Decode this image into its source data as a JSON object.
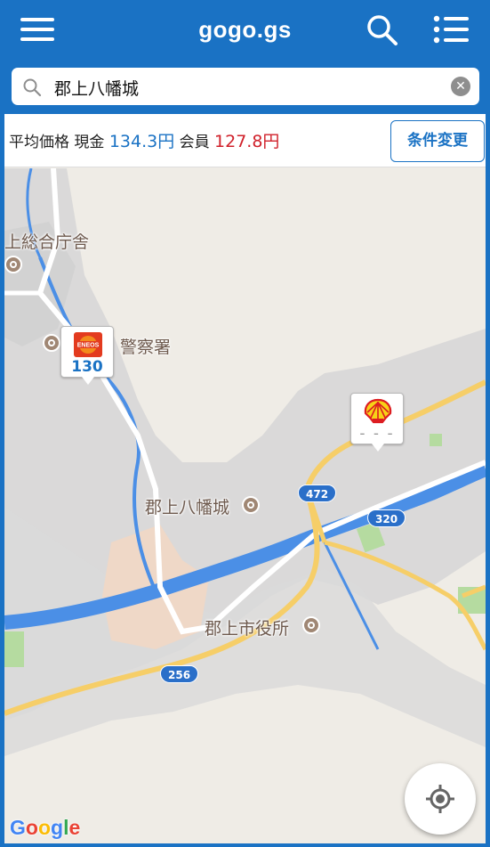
{
  "header": {
    "title": "gogo.gs"
  },
  "search": {
    "query": "郡上八幡城",
    "clear_label": "✕"
  },
  "prices": {
    "label_average": "平均価格",
    "label_cash": "現金",
    "cash_price": "134.3円",
    "label_member": "会員",
    "member_price": "127.8円",
    "condition_button": "条件変更"
  },
  "map": {
    "labels": {
      "gujo_office": "上総合庁舎",
      "police": "警察署",
      "castle": "郡上八幡城",
      "city_hall": "郡上市役所"
    },
    "routes": {
      "r472": "472",
      "r320": "320",
      "r256": "256"
    },
    "stations": [
      {
        "brand": "ENEOS",
        "price": "130"
      },
      {
        "brand": "Shell",
        "price": "- - -"
      }
    ],
    "attribution": "Google",
    "colors": {
      "water": "#4b8fe6",
      "land": "#efece6",
      "urban": "#d4d4d4",
      "park": "#b5dba0",
      "road_major": "#f6ce68",
      "brand_blue": "#1a72c4",
      "member_red": "#d0202a"
    }
  }
}
